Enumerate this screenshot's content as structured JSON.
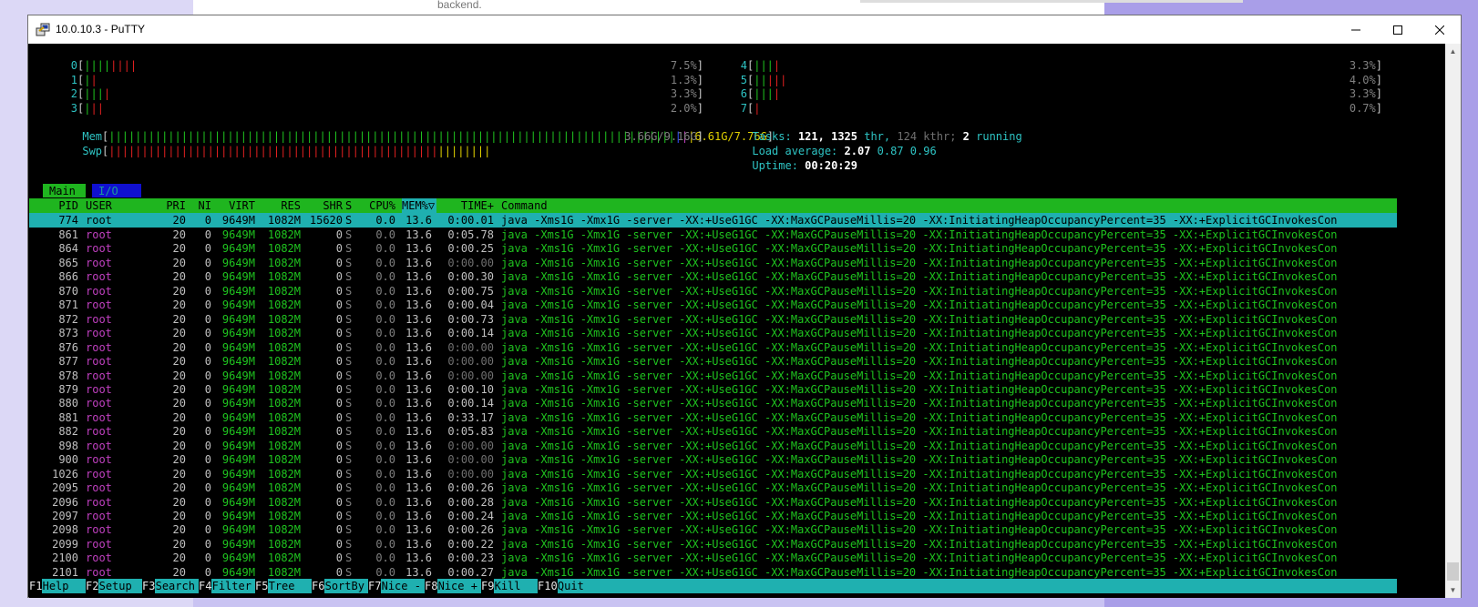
{
  "window": {
    "title": "10.0.10.3 - PuTTY"
  },
  "background": {
    "browser_text": "backend."
  },
  "cpus": [
    {
      "label": "0",
      "green": "||||",
      "red": "||||",
      "pct": "7.5%"
    },
    {
      "label": "1",
      "green": "|",
      "red": "|",
      "pct": "1.3%"
    },
    {
      "label": "2",
      "green": "|||",
      "red": "|",
      "pct": "3.3%"
    },
    {
      "label": "3",
      "green": "|",
      "red": "||",
      "pct": "2.0%"
    },
    {
      "label": "4",
      "green": "|||",
      "red": "|",
      "pct": "3.3%"
    },
    {
      "label": "5",
      "green": "||",
      "red": "|||",
      "pct": "4.0%"
    },
    {
      "label": "6",
      "green": "|||",
      "red": "|",
      "pct": "3.3%"
    },
    {
      "label": "7",
      "green": "",
      "red": "|",
      "pct": "0.7%"
    }
  ],
  "mem": {
    "label": "Mem",
    "green": "||||||||||||||||||||||||||||||||||||||||||||||||||||||||||||||||||||||||||||||||||||||",
    "blue": "|",
    "magenta": "|",
    "yellow": "|",
    "value": "6.61G/7.76G"
  },
  "swp": {
    "label": "Swp",
    "red": "||||||||||||||||||||||||||||||||||||||||||||||||||",
    "yellow": "||||||||",
    "value": "3.66G/9.16G"
  },
  "tasks": {
    "label": "Tasks:",
    "count": "121,",
    "thr": "1325",
    "thr_label": "thr,",
    "kthr": "124",
    "kthr_label": "kthr;",
    "running": "2",
    "running_label": "running"
  },
  "load": {
    "label": "Load average:",
    "v1": "2.07",
    "v5": "0.87",
    "v15": "0.96"
  },
  "uptime": {
    "label": "Uptime:",
    "value": "00:20:29"
  },
  "tabs": {
    "main": "Main",
    "io": "I/O"
  },
  "columns": {
    "pid": "PID",
    "user": "USER",
    "pri": "PRI",
    "ni": "NI",
    "virt": "VIRT",
    "res": "RES",
    "shr": "SHR",
    "s": "S",
    "cpu": "CPU%",
    "mem": "MEM%▽",
    "time": "TIME+",
    "cmd": "Command"
  },
  "selected": {
    "pid": "774",
    "user": "root",
    "pri": "20",
    "ni": "0",
    "virt": "9649M",
    "res": "1082M",
    "shr": "15620",
    "s": "S",
    "cpu": "0.0",
    "mem": "13.6",
    "time": "0:00.01",
    "cmd": "java -Xms1G -Xmx1G -server -XX:+UseG1GC -XX:MaxGCPauseMillis=20 -XX:InitiatingHeapOccupancyPercent=35 -XX:+ExplicitGCInvokesCon"
  },
  "cmd_text": "java -Xms1G -Xmx1G -server -XX:+UseG1GC -XX:MaxGCPauseMillis=20 -XX:InitiatingHeapOccupancyPercent=35 -XX:+ExplicitGCInvokesCon",
  "processes": [
    {
      "pid": "861",
      "time": "0:05.78"
    },
    {
      "pid": "864",
      "time": "0:00.25"
    },
    {
      "pid": "865",
      "time": "0:00.00"
    },
    {
      "pid": "866",
      "time": "0:00.30"
    },
    {
      "pid": "870",
      "time": "0:00.75"
    },
    {
      "pid": "871",
      "time": "0:00.04"
    },
    {
      "pid": "872",
      "time": "0:00.73"
    },
    {
      "pid": "873",
      "time": "0:00.14"
    },
    {
      "pid": "876",
      "time": "0:00.00"
    },
    {
      "pid": "877",
      "time": "0:00.00"
    },
    {
      "pid": "878",
      "time": "0:00.00"
    },
    {
      "pid": "879",
      "time": "0:00.10"
    },
    {
      "pid": "880",
      "time": "0:00.14"
    },
    {
      "pid": "881",
      "time": "0:33.17"
    },
    {
      "pid": "882",
      "time": "0:05.83"
    },
    {
      "pid": "898",
      "time": "0:00.00"
    },
    {
      "pid": "900",
      "time": "0:00.00"
    },
    {
      "pid": "1026",
      "time": "0:00.00"
    },
    {
      "pid": "2095",
      "time": "0:00.26"
    },
    {
      "pid": "2096",
      "time": "0:00.28"
    },
    {
      "pid": "2097",
      "time": "0:00.24"
    },
    {
      "pid": "2098",
      "time": "0:00.26"
    },
    {
      "pid": "2099",
      "time": "0:00.22"
    },
    {
      "pid": "2100",
      "time": "0:00.23"
    },
    {
      "pid": "2101",
      "time": "0:00.27"
    }
  ],
  "proc_defaults": {
    "user": "root",
    "pri": "20",
    "ni": "0",
    "virt": "9649M",
    "res": "1082M",
    "shr": "0",
    "s": "S",
    "cpu": "0.0",
    "mem": "13.6"
  },
  "footer": [
    {
      "key": "F1",
      "label": "Help"
    },
    {
      "key": "F2",
      "label": "Setup"
    },
    {
      "key": "F3",
      "label": "Search"
    },
    {
      "key": "F4",
      "label": "Filter"
    },
    {
      "key": "F5",
      "label": "Tree"
    },
    {
      "key": "F6",
      "label": "SortBy"
    },
    {
      "key": "F7",
      "label": "Nice -"
    },
    {
      "key": "F8",
      "label": "Nice +"
    },
    {
      "key": "F9",
      "label": "Kill"
    },
    {
      "key": "F10",
      "label": "Quit"
    }
  ]
}
